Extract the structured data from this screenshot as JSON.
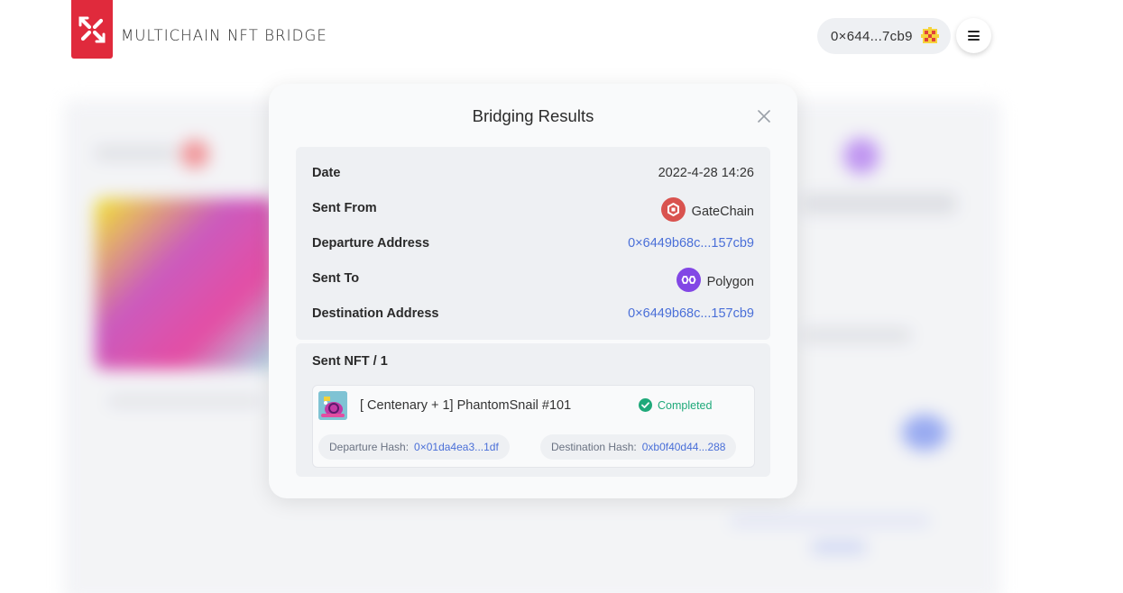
{
  "header": {
    "brand": "MULTICHAIN NFT BRIDGE",
    "wallet_address": "0×644...7cb9"
  },
  "modal": {
    "title": "Bridging Results",
    "details": {
      "date_label": "Date",
      "date_value": "2022-4-28 14:26",
      "sent_from_label": "Sent From",
      "sent_from_chain": "GateChain",
      "departure_address_label": "Departure Address",
      "departure_address_value": "0×6449b68c...157cb9",
      "sent_to_label": "Sent To",
      "sent_to_chain": "Polygon",
      "destination_address_label": "Destination Address",
      "destination_address_value": "0×6449b68c...157cb9"
    },
    "nft_section": {
      "title": "Sent NFT / 1",
      "items": [
        {
          "name": "[ Centenary + 1] PhantomSnail #101",
          "status": "Completed",
          "departure_hash_label": "Departure Hash:",
          "departure_hash_value": "0×01da4ea3...1df",
          "destination_hash_label": "Destination Hash:",
          "destination_hash_value": "0xb0f40d44...288"
        }
      ]
    }
  },
  "colors": {
    "brand_red": "#e02a3c",
    "link_blue": "#4a6fd8",
    "success_green": "#1fa97a",
    "gatechain_red": "#d9534f",
    "polygon_purple": "#8247e5"
  },
  "icons": {
    "logo": "multichain-x-logo",
    "wallet_avatar": "pixel-avatar-icon",
    "menu": "hamburger-icon",
    "close": "close-icon",
    "gatechain": "gatechain-icon",
    "polygon": "polygon-icon",
    "status": "check-circle-icon"
  }
}
